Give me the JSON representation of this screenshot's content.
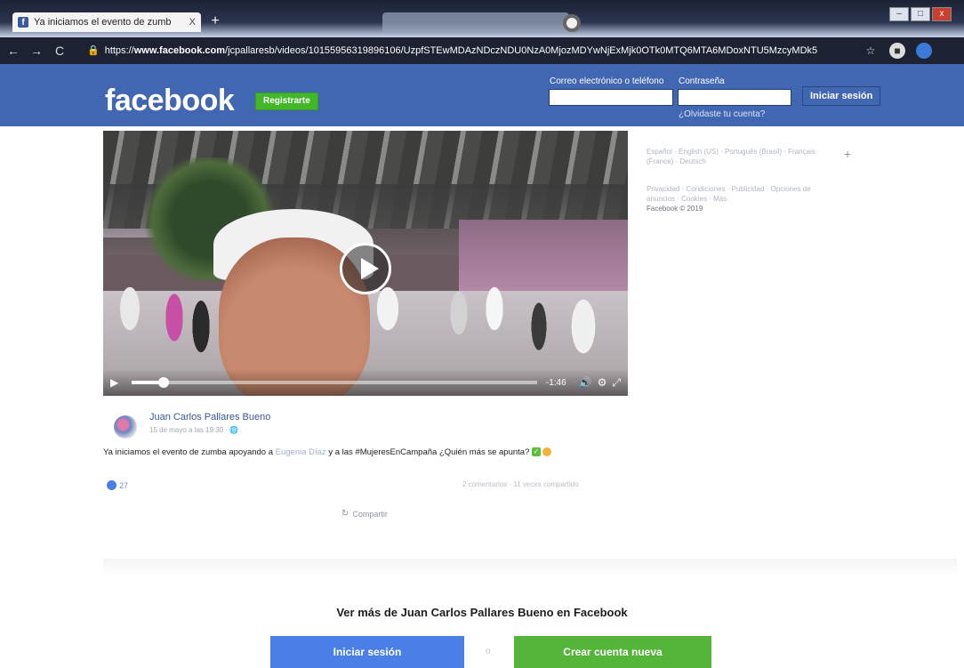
{
  "browser": {
    "tab_title": "Ya iniciamos el evento de zumb",
    "tab_close": "X",
    "new_tab": "+",
    "url_prefix": "https://",
    "url_host": "www.facebook.com",
    "url_path": "/jcpallaresb/videos/10155956319896106/UzpfSTEwMDAzNDczNDU0NzA0MjozMDYwNjExMjk0OTk0MTQ6MTA6MDoxNTU5MzcyMDk5",
    "back": "←",
    "forward": "→",
    "reload": "C",
    "star": "☆",
    "min": "–",
    "max": "□",
    "close": "x"
  },
  "header": {
    "logo": "facebook",
    "register_label": "Registrarte",
    "email_label": "Correo electrónico o teléfono",
    "password_label": "Contraseña",
    "login_label": "Iniciar sesión",
    "forgot_label": "¿Olvidaste tu cuenta?"
  },
  "video": {
    "progress": 0.08,
    "time_label": "-1:46"
  },
  "sidebar": {
    "languages": "Español · English (US) · Português (Brasil) · Français (France) · Deutsch",
    "footer_links": "Privacidad · Condiciones · Publicidad · Opciones de anuncios · Cookies · Más",
    "copyright": "Facebook © 2019",
    "plus": "+"
  },
  "post": {
    "author": "Juan Carlos Pallares Bueno",
    "meta": "15 de mayo a las 19:30 · ",
    "text_before": "Ya iniciamos el evento de zumba apoyando a ",
    "mention": "Eugenia Díaz",
    "text_after": " y a las #MujeresEnCampaña ¿Quién más se apunta?",
    "check_emoji": "✓",
    "reaction_count": "27",
    "counts": "2 comentarios · 11 veces compartido",
    "share_label": "Compartir",
    "share_icon": "↻"
  },
  "cta": {
    "title": "Ver más de Juan Carlos Pallares Bueno en Facebook",
    "login_label": "Iniciar sesión",
    "or_label": "o",
    "create_label": "Crear cuenta nueva"
  },
  "colors": {
    "brand_blue": "#4267b2",
    "register_green": "#42b72a",
    "cta_blue": "#4a7fe6",
    "cta_green": "#55b43a"
  }
}
